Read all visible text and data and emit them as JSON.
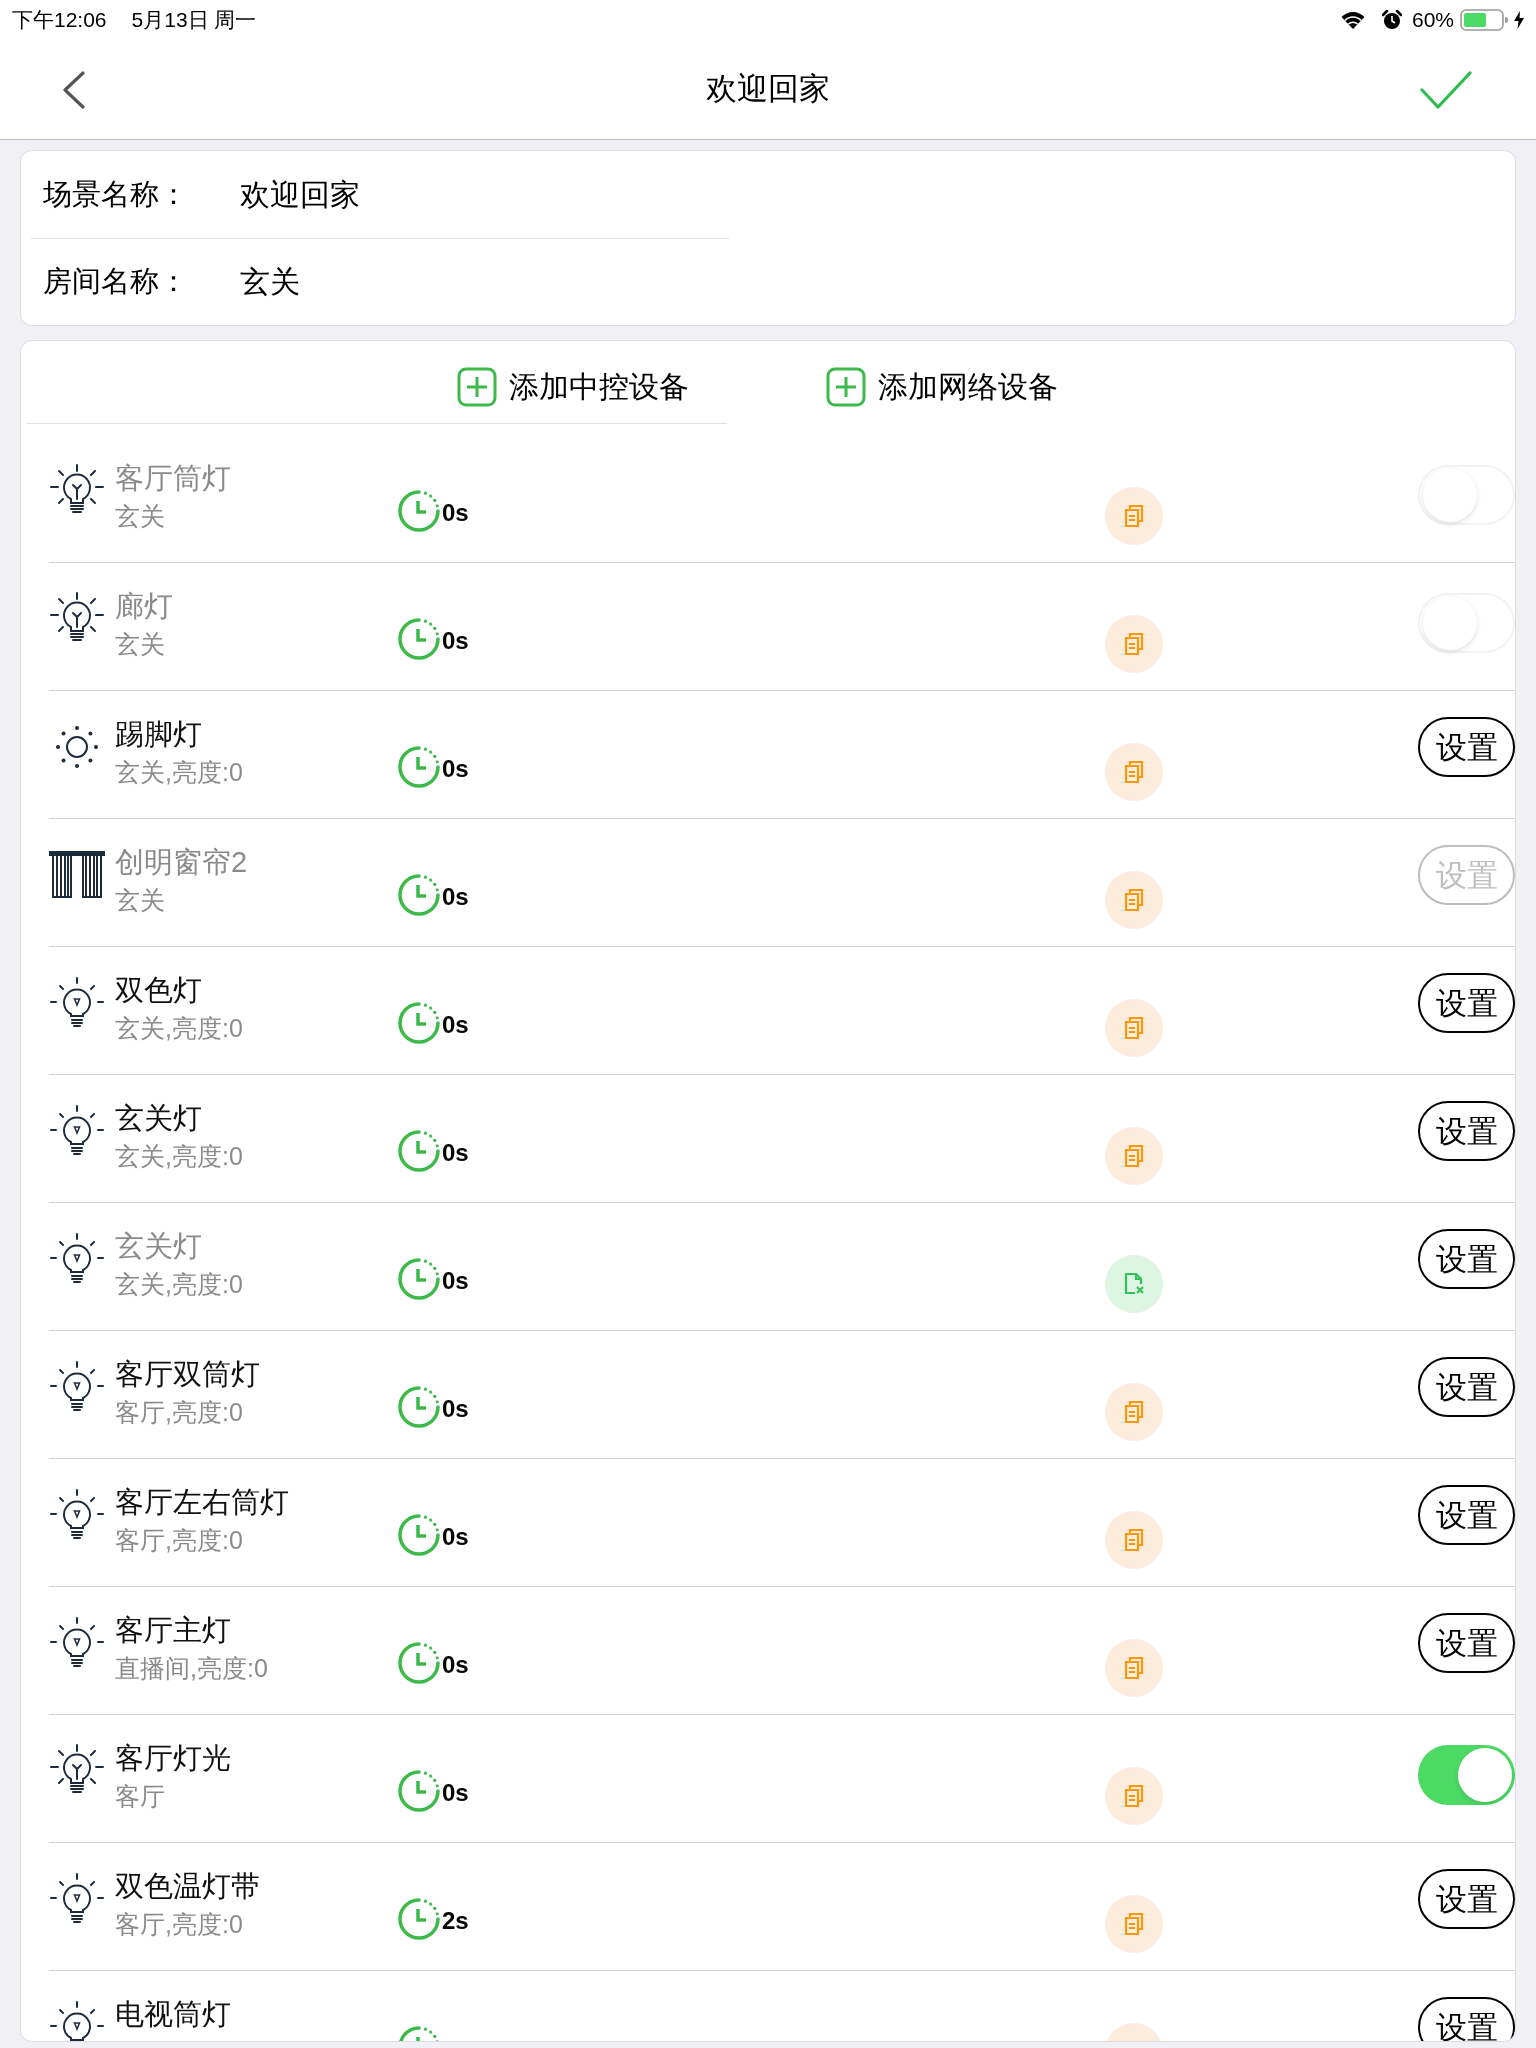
{
  "status_bar": {
    "time": "下午12:06",
    "date": "5月13日 周一",
    "battery": "60%"
  },
  "nav_bar": {
    "title": "欢迎回家"
  },
  "scene_info": [
    {
      "label": "场景名称：",
      "value": "欢迎回家"
    },
    {
      "label": "房间名称：",
      "value": "玄关"
    }
  ],
  "add_actions": [
    {
      "label": "添加中控设备"
    },
    {
      "label": "添加网络设备"
    }
  ],
  "devices": [
    {
      "kind": "bulb",
      "name": "客厅筒灯",
      "dimmed": true,
      "detail": "玄关",
      "delay": "0s",
      "copied": false,
      "control": {
        "kind": "toggle",
        "on": false
      }
    },
    {
      "kind": "bulb",
      "name": "廊灯",
      "dimmed": true,
      "detail": "玄关",
      "delay": "0s",
      "copied": false,
      "control": {
        "kind": "toggle",
        "on": false
      }
    },
    {
      "kind": "glow",
      "name": "踢脚灯",
      "dimmed": false,
      "detail": "玄关,亮度:0",
      "delay": "0s",
      "copied": false,
      "control": {
        "kind": "button",
        "label": "设置",
        "disabled": false
      }
    },
    {
      "kind": "curtain",
      "name": "创明窗帘2",
      "dimmed": true,
      "detail": "玄关",
      "delay": "0s",
      "copied": false,
      "control": {
        "kind": "button",
        "label": "设置",
        "disabled": true
      }
    },
    {
      "kind": "lamp",
      "name": "双色灯",
      "dimmed": false,
      "detail": "玄关,亮度:0",
      "delay": "0s",
      "copied": false,
      "control": {
        "kind": "button",
        "label": "设置",
        "disabled": false
      }
    },
    {
      "kind": "lamp",
      "name": "玄关灯",
      "dimmed": false,
      "detail": "玄关,亮度:0",
      "delay": "0s",
      "copied": false,
      "control": {
        "kind": "button",
        "label": "设置",
        "disabled": false
      }
    },
    {
      "kind": "lamp",
      "name": "玄关灯",
      "dimmed": true,
      "detail": "玄关,亮度:0",
      "delay": "0s",
      "copied": true,
      "control": {
        "kind": "button",
        "label": "设置",
        "disabled": false
      }
    },
    {
      "kind": "lamp",
      "name": "客厅双筒灯",
      "dimmed": false,
      "detail": "客厅,亮度:0",
      "delay": "0s",
      "copied": false,
      "control": {
        "kind": "button",
        "label": "设置",
        "disabled": false
      }
    },
    {
      "kind": "lamp",
      "name": "客厅左右筒灯",
      "dimmed": false,
      "detail": "客厅,亮度:0",
      "delay": "0s",
      "copied": false,
      "control": {
        "kind": "button",
        "label": "设置",
        "disabled": false
      }
    },
    {
      "kind": "lamp",
      "name": "客厅主灯",
      "dimmed": false,
      "detail": "直播间,亮度:0",
      "delay": "0s",
      "copied": false,
      "control": {
        "kind": "button",
        "label": "设置",
        "disabled": false
      }
    },
    {
      "kind": "bulb",
      "name": "客厅灯光",
      "dimmed": false,
      "detail": "客厅",
      "delay": "0s",
      "copied": false,
      "control": {
        "kind": "toggle",
        "on": true
      }
    },
    {
      "kind": "lamp",
      "name": "双色温灯带",
      "dimmed": false,
      "detail": "客厅,亮度:0",
      "delay": "2s",
      "copied": false,
      "control": {
        "kind": "button",
        "label": "设置",
        "disabled": false
      }
    },
    {
      "kind": "lamp",
      "name": "电视筒灯",
      "dimmed": false,
      "copied": false,
      "control": {
        "kind": "button",
        "label": "设置",
        "disabled": false
      }
    }
  ]
}
